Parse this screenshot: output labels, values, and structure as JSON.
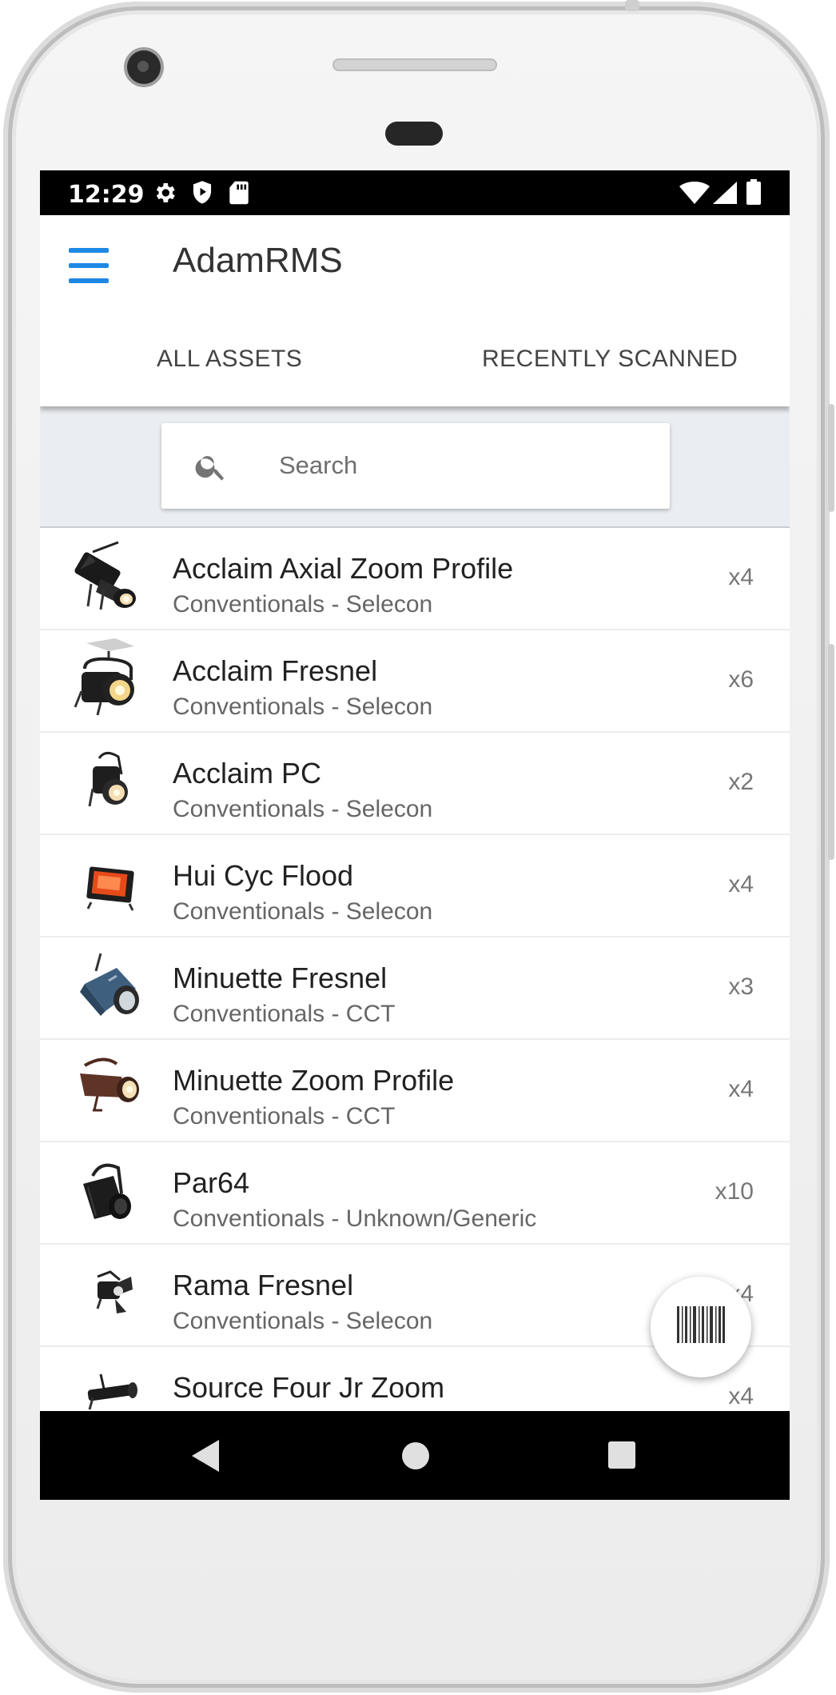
{
  "status_bar": {
    "time": "12:29"
  },
  "app_bar": {
    "title": "AdamRMS"
  },
  "tabs": [
    {
      "label": "ALL ASSETS"
    },
    {
      "label": "RECENTLY SCANNED"
    }
  ],
  "search": {
    "placeholder": "Search",
    "value": ""
  },
  "assets": [
    {
      "name": "Acclaim Axial Zoom Profile",
      "subtitle": "Conventionals - Selecon",
      "qty": "x4",
      "icon": "profile-spotlight-icon"
    },
    {
      "name": "Acclaim Fresnel",
      "subtitle": "Conventionals - Selecon",
      "qty": "x6",
      "icon": "fresnel-light-icon"
    },
    {
      "name": "Acclaim PC",
      "subtitle": "Conventionals - Selecon",
      "qty": "x2",
      "icon": "pc-light-icon"
    },
    {
      "name": "Hui Cyc Flood",
      "subtitle": "Conventionals - Selecon",
      "qty": "x4",
      "icon": "flood-light-icon"
    },
    {
      "name": "Minuette Fresnel",
      "subtitle": "Conventionals - CCT",
      "qty": "x3",
      "icon": "fresnel-light-icon"
    },
    {
      "name": "Minuette Zoom Profile",
      "subtitle": "Conventionals - CCT",
      "qty": "x4",
      "icon": "profile-spotlight-icon"
    },
    {
      "name": "Par64",
      "subtitle": "Conventionals - Unknown/Generic",
      "qty": "x10",
      "icon": "par-can-icon"
    },
    {
      "name": "Rama Fresnel",
      "subtitle": "Conventionals - Selecon",
      "qty": "x4",
      "icon": "fresnel-light-icon"
    },
    {
      "name": "Source Four Jr Zoom",
      "subtitle": "",
      "qty": "x4",
      "icon": "profile-spotlight-icon"
    }
  ],
  "fab": {
    "icon": "barcode-icon"
  },
  "nav_bar": {
    "back": "back-icon",
    "home": "home-icon",
    "recents": "recents-icon"
  },
  "colors": {
    "accent": "#1e88e5",
    "status_bar": "#000000",
    "search_area": "#eaedf1"
  }
}
